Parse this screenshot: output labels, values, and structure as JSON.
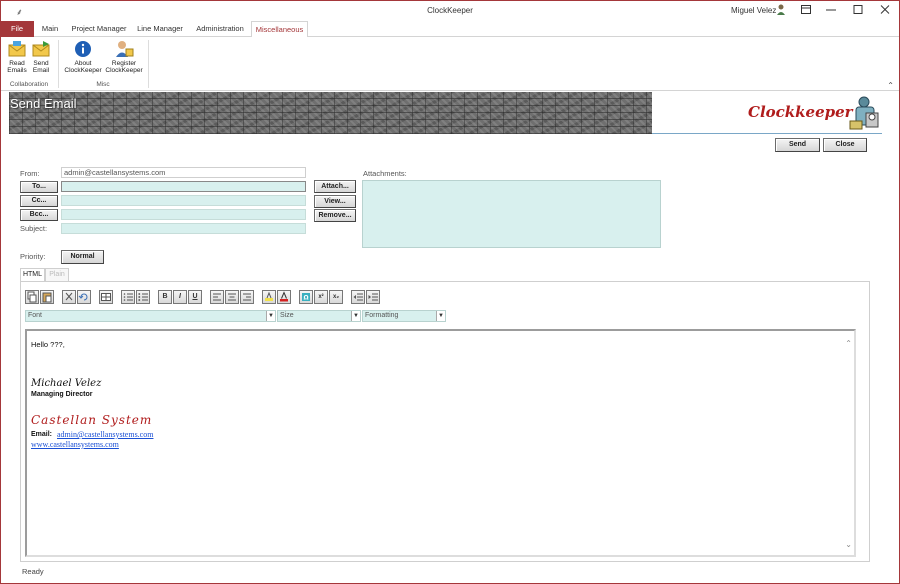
{
  "window": {
    "title": "ClockKeeper",
    "user": "Miguel Velez",
    "qat_glyph": "⸙"
  },
  "ribbon": {
    "tabs": [
      {
        "label": "File"
      },
      {
        "label": "Main"
      },
      {
        "label": "Project Manager"
      },
      {
        "label": "Line Manager"
      },
      {
        "label": "Administration"
      },
      {
        "label": "Miscellaneous"
      }
    ],
    "groups": {
      "collaboration": {
        "label": "Collaboration",
        "read": {
          "line1": "Read",
          "line2": "Emails"
        },
        "send": {
          "line1": "Send",
          "line2": "Email"
        }
      },
      "misc": {
        "label": "Misc",
        "about": {
          "line1": "About",
          "line2": "ClockKeeper"
        },
        "register": {
          "line1": "Register",
          "line2": "ClockKeeper"
        }
      }
    }
  },
  "form": {
    "title": "Send Email",
    "logo_text": "Clockkeeper",
    "send_label": "Send",
    "close_label": "Close",
    "from_label": "From:",
    "from_value": "admin@castellansystems.com",
    "to_label": "To...",
    "cc_label": "Cc...",
    "bcc_label": "Bcc...",
    "subject_label": "Subject:",
    "attach_label": "Attach...",
    "view_label": "View...",
    "remove_label": "Remove...",
    "attachments_label": "Attachments:",
    "priority_label": "Priority:",
    "priority_value": "Normal"
  },
  "editor": {
    "tab_html": "HTML",
    "tab_plain": "Plain",
    "font_placeholder": "Font",
    "size_placeholder": "Size",
    "format_placeholder": "Formatting",
    "toolbar": [
      "copy-icon",
      "paste-icon",
      "cut-icon",
      "undo-icon",
      "table-icon",
      "ordered-list-icon",
      "unordered-list-icon",
      "bold-icon",
      "italic-icon",
      "underline-icon",
      "align-left-icon",
      "align-center-icon",
      "align-right-icon",
      "highlight-icon",
      "font-color-icon",
      "special-char-icon",
      "superscript-icon",
      "subscript-icon",
      "outdent-icon",
      "indent-icon"
    ],
    "toolbar_glyphs": {
      "bold": "B",
      "italic": "I",
      "underline": "U",
      "superscript": "x²",
      "subscript": "x₂"
    },
    "body": {
      "greeting": "Hello ???,",
      "sig_name": "Michael Velez",
      "sig_role": "Managing Director",
      "sig_company": "Castellan System",
      "sig_email_label": "Email:",
      "sig_email": "admin@castellansystems.com",
      "sig_web": "www.castellansystems.com"
    }
  },
  "status": "Ready",
  "colors": {
    "accent": "#a4373a",
    "field_bg": "#d8f0ee",
    "logo_red": "#b01c1c",
    "link": "#1a4fd4"
  }
}
